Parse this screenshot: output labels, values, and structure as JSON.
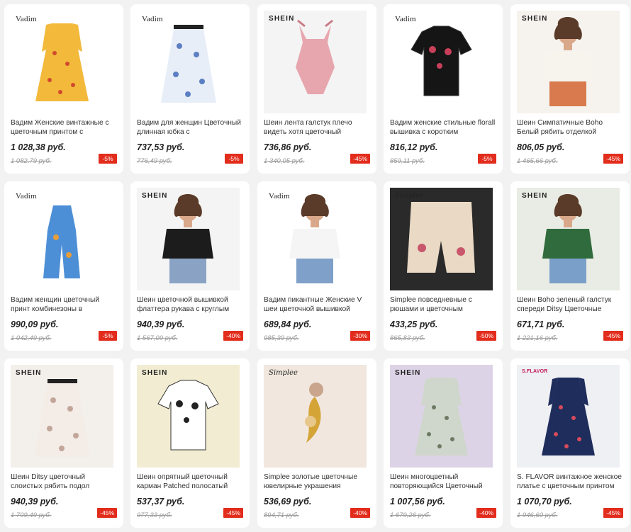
{
  "products": [
    {
      "brand": "Vadim",
      "brand_style": "vadim",
      "title": "Вадим Женские винтажные с цветочным принтом с",
      "price": "1 028,38 руб.",
      "old_price": "1 082,79 руб.",
      "discount": "-5%",
      "bg": "#ffffff",
      "garment": "dress",
      "color": "#f2b93b",
      "accent": "#d1492f"
    },
    {
      "brand": "Vadim",
      "brand_style": "vadim",
      "title": "Вадим для женщин Цветочный длинная юбка с",
      "price": "737,53 руб.",
      "old_price": "776,49 руб.",
      "discount": "-5%",
      "bg": "#ffffff",
      "garment": "skirt",
      "color": "#e8eef8",
      "accent": "#5b7fc2"
    },
    {
      "brand": "SHEIN",
      "brand_style": "shein",
      "title": "Шеин лента галстук плечо видеть хотя цветочный",
      "price": "736,86 руб.",
      "old_price": "1 340,05 руб.",
      "discount": "-45%",
      "bg": "#f4f4f4",
      "garment": "bodysuit",
      "color": "#e7a6ae",
      "accent": "#c97b86"
    },
    {
      "brand": "Vadim",
      "brand_style": "vadim",
      "title": "Вадим женские стильные florall вышивка с коротким",
      "price": "816,12 руб.",
      "old_price": "859,11 руб.",
      "discount": "-5%",
      "bg": "#ffffff",
      "garment": "tshirt",
      "color": "#151515",
      "accent": "#c9405a"
    },
    {
      "brand": "SHEIN",
      "brand_style": "shein",
      "title": "Шеин Симпатичные Boho Белый рябить отделкой",
      "price": "806,05 руб.",
      "old_price": "1 465,66 руб.",
      "discount": "-45%",
      "bg": "#f6f3ef",
      "garment": "model",
      "color": "#f7f4ee",
      "accent": "#d87a4e"
    },
    {
      "brand": "Vadim",
      "brand_style": "vadim",
      "title": "Вадим женщин цветочный принт комбинезоны в",
      "price": "990,09 руб.",
      "old_price": "1 042,49 руб.",
      "discount": "-5%",
      "bg": "#ffffff",
      "garment": "jumpsuit",
      "color": "#4d8fd6",
      "accent": "#e79e3a"
    },
    {
      "brand": "SHEIN",
      "brand_style": "shein",
      "title": "Шеин цветочной вышивкой флаттера рукава с круглым",
      "price": "940,39 руб.",
      "old_price": "1 567,09 руб.",
      "discount": "-40%",
      "bg": "#f4f4f4",
      "garment": "model",
      "color": "#1c1c1c",
      "accent": "#8aa3c4"
    },
    {
      "brand": "Vadim",
      "brand_style": "vadim",
      "title": "Вадим пикантные Женские V шеи цветочной вышивкой",
      "price": "689,84 руб.",
      "old_price": "985,39 руб.",
      "discount": "-30%",
      "bg": "#ffffff",
      "garment": "model",
      "color": "#f5f5f5",
      "accent": "#7fa0c8"
    },
    {
      "brand": "Simplee",
      "brand_style": "simplee",
      "title": "Simplee повседневные с рюшами и цветочным",
      "price": "433,25 руб.",
      "old_price": "865,83 руб.",
      "discount": "-50%",
      "bg": "#2a2a2a",
      "garment": "shorts",
      "color": "#e9d9c5",
      "accent": "#c9576b"
    },
    {
      "brand": "SHEIN",
      "brand_style": "shein",
      "title": "Шеин Boho зеленый галстук спереди Ditsy Цветочные",
      "price": "671,71 руб.",
      "old_price": "1 221,16 руб.",
      "discount": "-45%",
      "bg": "#e8ece4",
      "garment": "model",
      "color": "#2f6b3c",
      "accent": "#7aa0c9"
    },
    {
      "brand": "SHEIN",
      "brand_style": "shein",
      "title": "Шеин Ditsy цветочный слоистых рябить подол",
      "price": "940,39 руб.",
      "old_price": "1 709,49 руб.",
      "discount": "-45%",
      "bg": "#f3efea",
      "garment": "skirt",
      "color": "#f4ece6",
      "accent": "#c2a69a"
    },
    {
      "brand": "SHEIN",
      "brand_style": "shein",
      "title": "Шеин опрятный цветочный карман Patched полосатый",
      "price": "537,37 руб.",
      "old_price": "977,33 руб.",
      "discount": "-45%",
      "bg": "#f2ecd2",
      "garment": "tshirt",
      "color": "#ffffff",
      "accent": "#222222"
    },
    {
      "brand": "Simplee",
      "brand_style": "simplee",
      "title": "Simplee золотые цветочные ювелирные украшения",
      "price": "536,69 руб.",
      "old_price": "894,71 руб.",
      "discount": "-40%",
      "bg": "#f1e7de",
      "garment": "earring",
      "color": "#d4a437",
      "accent": "#e7c78a"
    },
    {
      "brand": "SHEIN",
      "brand_style": "shein",
      "title": "Шеин многоцветный повторяющийся Цветочный",
      "price": "1 007,56 руб.",
      "old_price": "1 679,26 руб.",
      "discount": "-40%",
      "bg": "#ddd3e6",
      "garment": "dress",
      "color": "#cfd6cc",
      "accent": "#6c7a63"
    },
    {
      "brand": "S.FLAVOR",
      "brand_style": "sflavor",
      "title": "S. FLAVOR винтажное женское платье с цветочным принтом",
      "price": "1 070,70 руб.",
      "old_price": "1 946,60 руб.",
      "discount": "-45%",
      "bg": "#eef0f4",
      "garment": "dress",
      "color": "#1f2d5c",
      "accent": "#d64b5a"
    }
  ]
}
